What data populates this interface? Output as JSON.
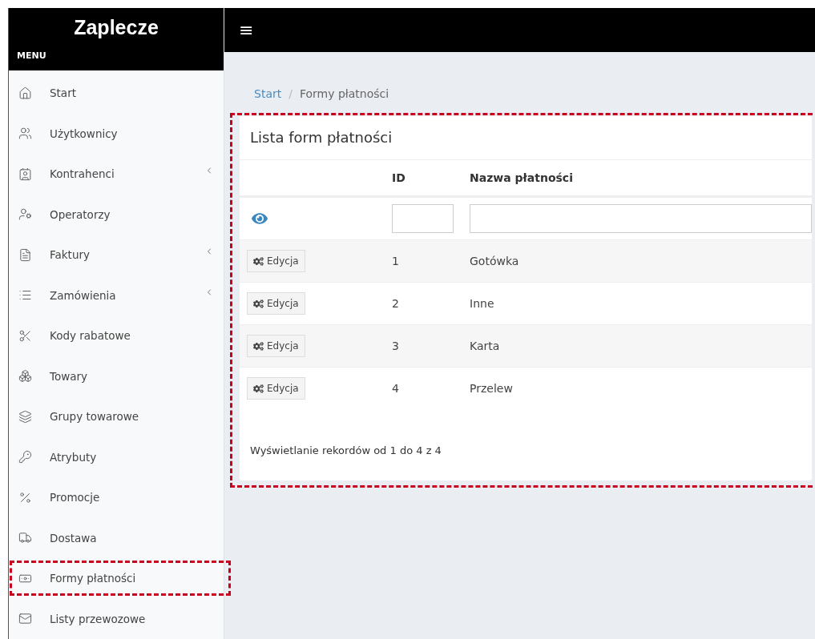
{
  "brand": "Zaplecze",
  "menu_label": "MENU",
  "menu_toggle": "≡",
  "sidebar": {
    "items": [
      {
        "label": "Start",
        "expandable": false,
        "highlighted": false
      },
      {
        "label": "Użytkownicy",
        "expandable": false,
        "highlighted": false
      },
      {
        "label": "Kontrahenci",
        "expandable": true,
        "highlighted": false
      },
      {
        "label": "Operatorzy",
        "expandable": false,
        "highlighted": false
      },
      {
        "label": "Faktury",
        "expandable": true,
        "highlighted": false
      },
      {
        "label": "Zamówienia",
        "expandable": true,
        "highlighted": false
      },
      {
        "label": "Kody rabatowe",
        "expandable": false,
        "highlighted": false
      },
      {
        "label": "Towary",
        "expandable": false,
        "highlighted": false
      },
      {
        "label": "Grupy towarowe",
        "expandable": false,
        "highlighted": false
      },
      {
        "label": "Atrybuty",
        "expandable": false,
        "highlighted": false
      },
      {
        "label": "Promocje",
        "expandable": false,
        "highlighted": false
      },
      {
        "label": "Dostawa",
        "expandable": false,
        "highlighted": false
      },
      {
        "label": "Formy płatności",
        "expandable": false,
        "highlighted": true
      },
      {
        "label": "Listy przewozowe",
        "expandable": false,
        "highlighted": false
      }
    ]
  },
  "breadcrumb_separator": "/",
  "breadcrumb": [
    {
      "label": "Start",
      "kind": "link"
    },
    {
      "label": "Formy płatności",
      "kind": "current"
    }
  ],
  "card": {
    "title": "Lista form płatności",
    "highlighted": true,
    "table": {
      "columns": [
        "ID",
        "Nazwa płatności"
      ],
      "rows": [
        {
          "action": "Edycja",
          "id": "1",
          "name": "Gotówka"
        },
        {
          "action": "Edycja",
          "id": "2",
          "name": "Inne"
        },
        {
          "action": "Edycja",
          "id": "3",
          "name": "Karta"
        },
        {
          "action": "Edycja",
          "id": "4",
          "name": "Przelew"
        }
      ]
    },
    "footer": "Wyświetlanie rekordów od 1 do 4 z 4"
  }
}
